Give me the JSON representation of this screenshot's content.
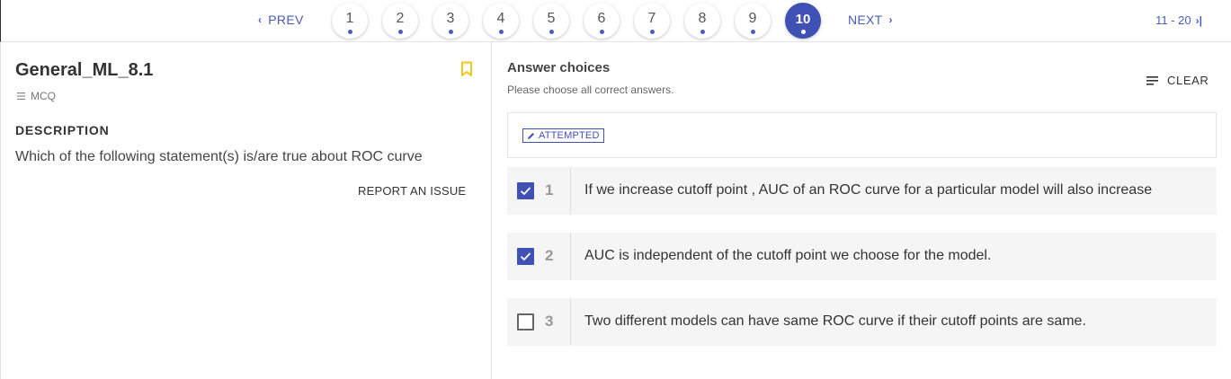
{
  "nav": {
    "prev_label": "PREV",
    "next_label": "NEXT",
    "pages": [
      "1",
      "2",
      "3",
      "4",
      "5",
      "6",
      "7",
      "8",
      "9",
      "10"
    ],
    "active_page": "10",
    "range_label": "11 - 20",
    "accent_color": "#3f51b5"
  },
  "question": {
    "title": "General_ML_8.1",
    "type": "MCQ",
    "description_heading": "DESCRIPTION",
    "description": "Which  of the following statement(s) is/are  true about ROC curve",
    "report_label": "REPORT AN ISSUE",
    "bookmark_icon": "bookmark-icon",
    "bookmark_color": "#f5c518"
  },
  "answers": {
    "title": "Answer choices",
    "subtitle": "Please choose all correct answers.",
    "clear_label": "CLEAR",
    "status_badge": "ATTEMPTED",
    "options": [
      {
        "index": "1",
        "text": "If we increase cutoff point , AUC of an ROC curve for a particular model will also increase",
        "checked": true
      },
      {
        "index": "2",
        "text": "AUC is independent of the cutoff point we choose for the model.",
        "checked": true
      },
      {
        "index": "3",
        "text": "Two different models can have same ROC curve if their cutoff points are same.",
        "checked": false
      }
    ]
  }
}
